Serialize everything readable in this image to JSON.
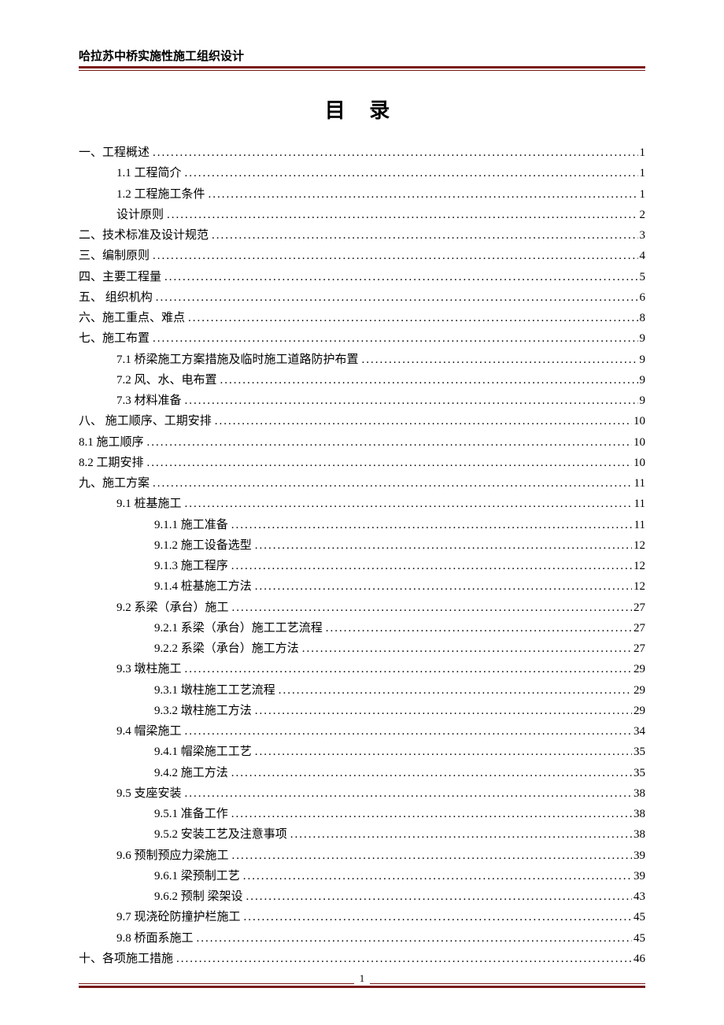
{
  "header": {
    "doc_title": "哈拉苏中桥实施性施工组织设计"
  },
  "title": "目  录",
  "footer": {
    "page_number": "1"
  },
  "toc": [
    {
      "label": "一、工程概述",
      "page": "1",
      "indent": 0
    },
    {
      "label": "1.1 工程简介",
      "page": "1",
      "indent": 1
    },
    {
      "label": "1.2 工程施工条件",
      "page": "1",
      "indent": 1
    },
    {
      "label": "设计原则",
      "page": "2",
      "indent": 1
    },
    {
      "label": "二、技术标准及设计规范",
      "page": "3",
      "indent": 0
    },
    {
      "label": "三、编制原则",
      "page": "4",
      "indent": 0
    },
    {
      "label": "四、主要工程量",
      "page": "5",
      "indent": 0
    },
    {
      "label": "五、  组织机构",
      "page": "6",
      "indent": 0
    },
    {
      "label": "六、施工重点、难点",
      "page": "8",
      "indent": 0
    },
    {
      "label": "七、施工布置",
      "page": "9",
      "indent": 0
    },
    {
      "label": "7.1 桥梁施工方案措施及临时施工道路防护布置",
      "page": "9",
      "indent": 1
    },
    {
      "label": "7.2 风、水、电布置",
      "page": "9",
      "indent": 1
    },
    {
      "label": "7.3 材料准备",
      "page": "9",
      "indent": 1
    },
    {
      "label": "八、  施工顺序、工期安排",
      "page": "10",
      "indent": 0
    },
    {
      "label": "8.1 施工顺序",
      "page": "10",
      "indent": 0
    },
    {
      "label": "8.2 工期安排",
      "page": "10",
      "indent": 0
    },
    {
      "label": "九、施工方案",
      "page": "11",
      "indent": 0
    },
    {
      "label": "9.1 桩基施工",
      "page": "11",
      "indent": 1
    },
    {
      "label": "9.1.1 施工准备",
      "page": "11",
      "indent": 2
    },
    {
      "label": "9.1.2 施工设备选型",
      "page": "12",
      "indent": 2
    },
    {
      "label": "9.1.3 施工程序",
      "page": "12",
      "indent": 2
    },
    {
      "label": "9.1.4 桩基施工方法",
      "page": "12",
      "indent": 2
    },
    {
      "label": "9.2 系梁（承台）施工",
      "page": "27",
      "indent": 1
    },
    {
      "label": "9.2.1 系梁（承台）施工工艺流程",
      "page": "27",
      "indent": 2
    },
    {
      "label": "9.2.2 系梁（承台）施工方法",
      "page": "27",
      "indent": 2
    },
    {
      "label": "9.3 墩柱施工",
      "page": "29",
      "indent": 1
    },
    {
      "label": "9.3.1 墩柱施工工艺流程",
      "page": "29",
      "indent": 2
    },
    {
      "label": "9.3.2 墩柱施工方法",
      "page": "29",
      "indent": 2
    },
    {
      "label": "9.4 帽梁施工",
      "page": "34",
      "indent": 1
    },
    {
      "label": "9.4.1 帽梁施工工艺",
      "page": "35",
      "indent": 2
    },
    {
      "label": "9.4.2 施工方法",
      "page": "35",
      "indent": 2
    },
    {
      "label": "9.5 支座安装",
      "page": "38",
      "indent": 1
    },
    {
      "label": "9.5.1 准备工作",
      "page": "38",
      "indent": 2
    },
    {
      "label": "9.5.2 安装工艺及注意事项",
      "page": "38",
      "indent": 2
    },
    {
      "label": "9.6 预制预应力梁施工",
      "page": "39",
      "indent": 1
    },
    {
      "label": "9.6.1 梁预制工艺",
      "page": "39",
      "indent": 2
    },
    {
      "label": "9.6.2 预制  梁架设",
      "page": "43",
      "indent": 2
    },
    {
      "label": "9.7 现浇砼防撞护栏施工",
      "page": "45",
      "indent": 1
    },
    {
      "label": "9.8 桥面系施工",
      "page": "45",
      "indent": 1
    },
    {
      "label": "十、各项施工措施",
      "page": "46",
      "indent": 0
    }
  ]
}
